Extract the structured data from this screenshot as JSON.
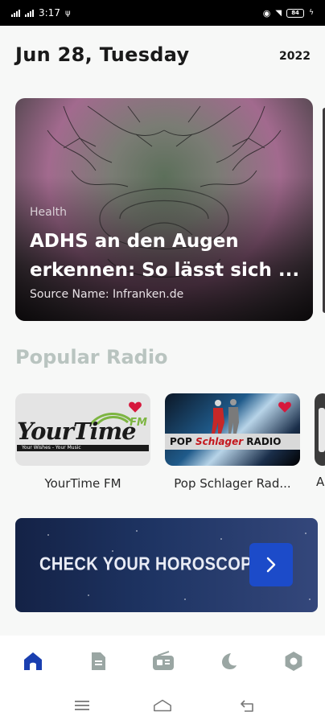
{
  "status_bar": {
    "time": "3:17",
    "battery": "84"
  },
  "header": {
    "date": "Jun 28, Tuesday",
    "year": "2022"
  },
  "news": {
    "category": "Health",
    "title": "ADHS an den Augen erkennen: So lässt sich ...",
    "source": "Source Name: Infranken.de"
  },
  "popular_radio": {
    "title": "Popular Radio",
    "items": [
      {
        "name": "YourTime FM",
        "logo_text": "YourTime",
        "logo_suffix": "FM",
        "tagline": "Your Wishes - Your Music"
      },
      {
        "name": "Pop Schlager Rad...",
        "logo_pre": "POP ",
        "logo_mid": "Schlager",
        "logo_post": " RADIO"
      },
      {
        "name": "A"
      }
    ]
  },
  "horoscope": {
    "label": "CHECK YOUR HOROSCOPE"
  },
  "bottom_nav": {
    "items": [
      {
        "icon": "home-icon",
        "active": true
      },
      {
        "icon": "document-icon",
        "active": false
      },
      {
        "icon": "radio-icon",
        "active": false
      },
      {
        "icon": "moon-icon",
        "active": false
      },
      {
        "icon": "settings-icon",
        "active": false
      }
    ]
  },
  "colors": {
    "accent": "#1a3fb0",
    "inactive": "#9aa6a3",
    "section_title": "#b9c4c0",
    "heart": "#d6183c"
  }
}
